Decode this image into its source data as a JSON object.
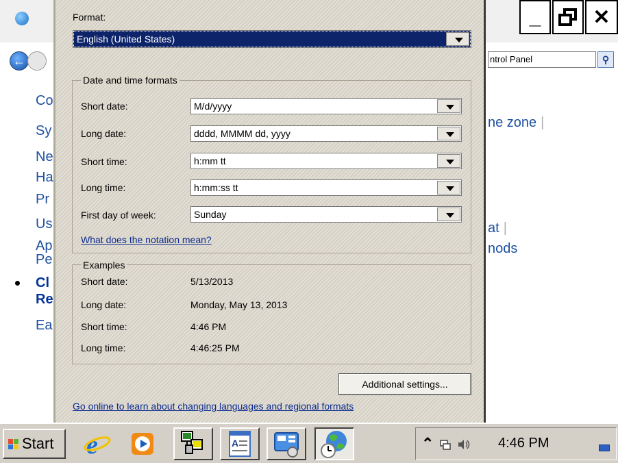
{
  "background_window": {
    "address_text": "ntrol Panel",
    "left_items": [
      "Co",
      "Sy",
      "Ne",
      "Ha",
      "Pr",
      "Us",
      "Ap",
      "Pe",
      "Cl",
      "Re",
      "Ea"
    ],
    "right_items": [
      "ne zone",
      "at",
      "nods"
    ],
    "window_buttons": {
      "minimize": "_",
      "restore": "🗗",
      "close": "✕"
    }
  },
  "dialog": {
    "format_label": "Format:",
    "format_value": "English (United States)",
    "date_time_group": "Date and time formats",
    "fields": [
      {
        "label": "Short date:",
        "value": "M/d/yyyy"
      },
      {
        "label": "Long date:",
        "value": "dddd, MMMM dd, yyyy"
      },
      {
        "label": "Short time:",
        "value": "h:mm tt"
      },
      {
        "label": "Long time:",
        "value": "h:mm:ss tt"
      },
      {
        "label": "First day of week:",
        "value": "Sunday"
      }
    ],
    "notation_link": "What does the notation mean?",
    "examples_group": "Examples",
    "examples": [
      {
        "label": "Short date:",
        "value": "5/13/2013"
      },
      {
        "label": "Long date:",
        "value": "Monday, May 13, 2013"
      },
      {
        "label": "Short time:",
        "value": "4:46 PM"
      },
      {
        "label": "Long time:",
        "value": "4:46:25 PM"
      }
    ],
    "additional_settings_button": "Additional settings...",
    "online_link": "Go online to learn about changing languages and regional formats"
  },
  "taskbar": {
    "start_label": "Start",
    "tray_expand": "⌃",
    "clock": "4:46 PM",
    "apps": [
      "internet-explorer",
      "media-player",
      "network-connections",
      "wordpad",
      "control-panel",
      "region-globe"
    ]
  },
  "colors": {
    "dialog_bg": "#ddd8cc",
    "selection": "#0d246a",
    "link": "#0b2b8f",
    "taskbar": "#d4d0c8"
  }
}
